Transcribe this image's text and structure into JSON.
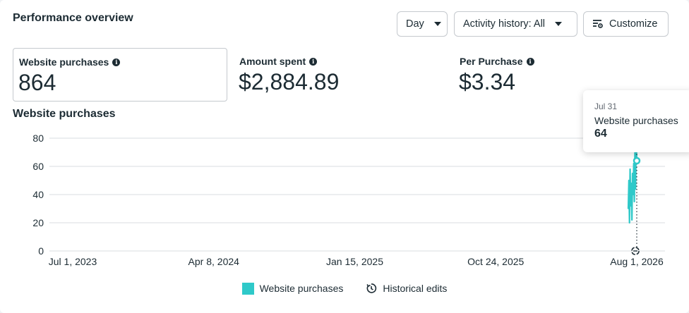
{
  "header": {
    "title": "Performance overview",
    "day_label": "Day",
    "activity_label": "Activity history: All",
    "customize_label": "Customize"
  },
  "metrics": [
    {
      "label": "Website purchases",
      "value": "864"
    },
    {
      "label": "Amount spent",
      "value": "$2,884.89"
    },
    {
      "label": "Per Purchase",
      "value": "$3.34"
    }
  ],
  "chart_section_title": "Website purchases",
  "tooltip": {
    "date": "Jul 31",
    "label": "Website purchases",
    "value": "64"
  },
  "legend": {
    "series_label": "Website purchases",
    "edits_label": "Historical edits"
  },
  "colors": {
    "series": "#2fc9c9",
    "text": "#1c2b33",
    "grid": "#dadde1"
  },
  "icons": [
    "info-icon",
    "chevron-down-icon",
    "customize-sliders-icon",
    "historical-edits-icon"
  ],
  "chart_data": {
    "type": "line",
    "title": "Website purchases",
    "xlabel": "",
    "ylabel": "",
    "ylim": [
      0,
      80
    ],
    "yticks": [
      0,
      20,
      40,
      60,
      80
    ],
    "x_tick_labels": [
      "Jul 1, 2023",
      "Apr 8, 2024",
      "Jan 15, 2025",
      "Oct 24, 2025",
      "Aug 1, 2026"
    ],
    "x_range": [
      "2023-07-01",
      "2026-08-01"
    ],
    "grid": true,
    "legend_position": "bottom",
    "series": [
      {
        "name": "Website purchases",
        "x": [
          "2026-07-17",
          "2026-07-18",
          "2026-07-19",
          "2026-07-20",
          "2026-07-21",
          "2026-07-22",
          "2026-07-23",
          "2026-07-24",
          "2026-07-25",
          "2026-07-26",
          "2026-07-27",
          "2026-07-28",
          "2026-07-29",
          "2026-07-30",
          "2026-07-31"
        ],
        "values": [
          30,
          50,
          20,
          58,
          32,
          48,
          22,
          55,
          40,
          62,
          35,
          70,
          44,
          80,
          64
        ]
      }
    ],
    "highlighted_point": {
      "x": "2026-07-31",
      "y": 64
    }
  }
}
